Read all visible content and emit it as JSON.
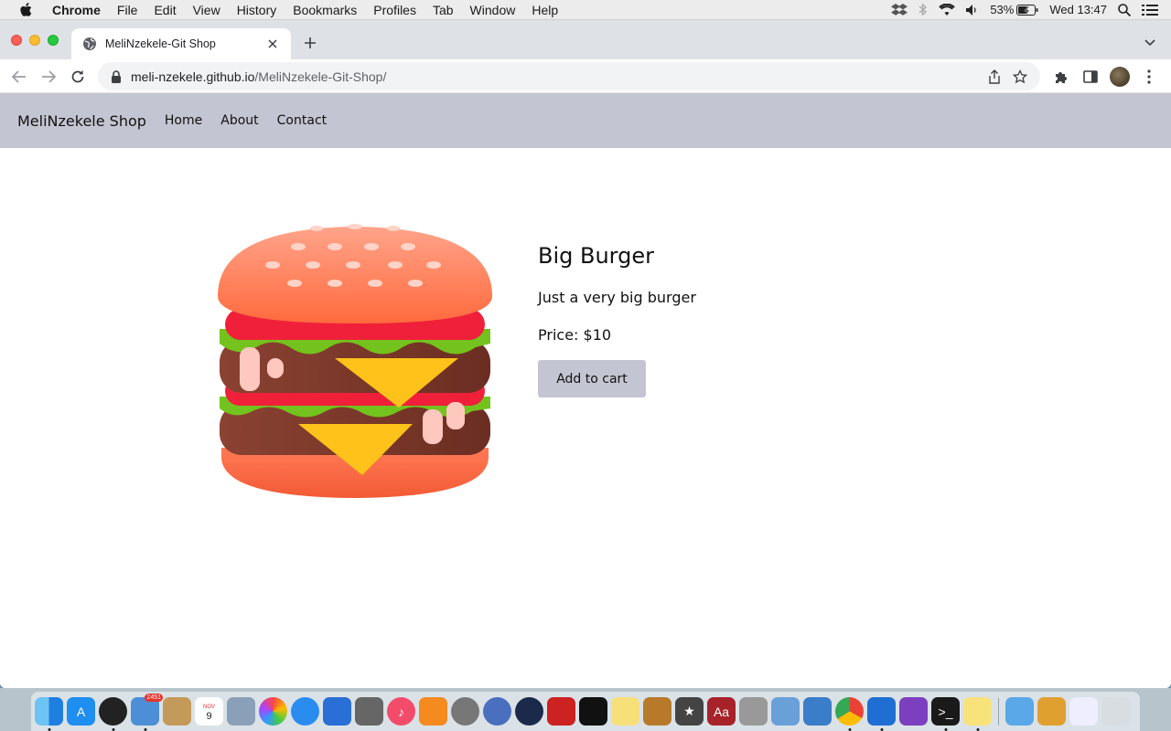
{
  "menubar": {
    "app_name": "Chrome",
    "menus": [
      "File",
      "Edit",
      "View",
      "History",
      "Bookmarks",
      "Profiles",
      "Tab",
      "Window",
      "Help"
    ],
    "battery": "53%",
    "clock": "Wed 13:47"
  },
  "browser": {
    "tab_title": "MeliNzekele-Git Shop",
    "url_host": "meli-nzekele.github.io",
    "url_path": "/MeliNzekele-Git-Shop/"
  },
  "site": {
    "brand": "MeliNzekele Shop",
    "nav": [
      "Home",
      "About",
      "Contact"
    ]
  },
  "product": {
    "title": "Big Burger",
    "description": "Just a very big burger",
    "price": "Price: $10",
    "cta": "Add to cart"
  },
  "dock": {
    "mail_badge": "2451",
    "calendar_month": "NOV",
    "calendar_day": "9"
  }
}
